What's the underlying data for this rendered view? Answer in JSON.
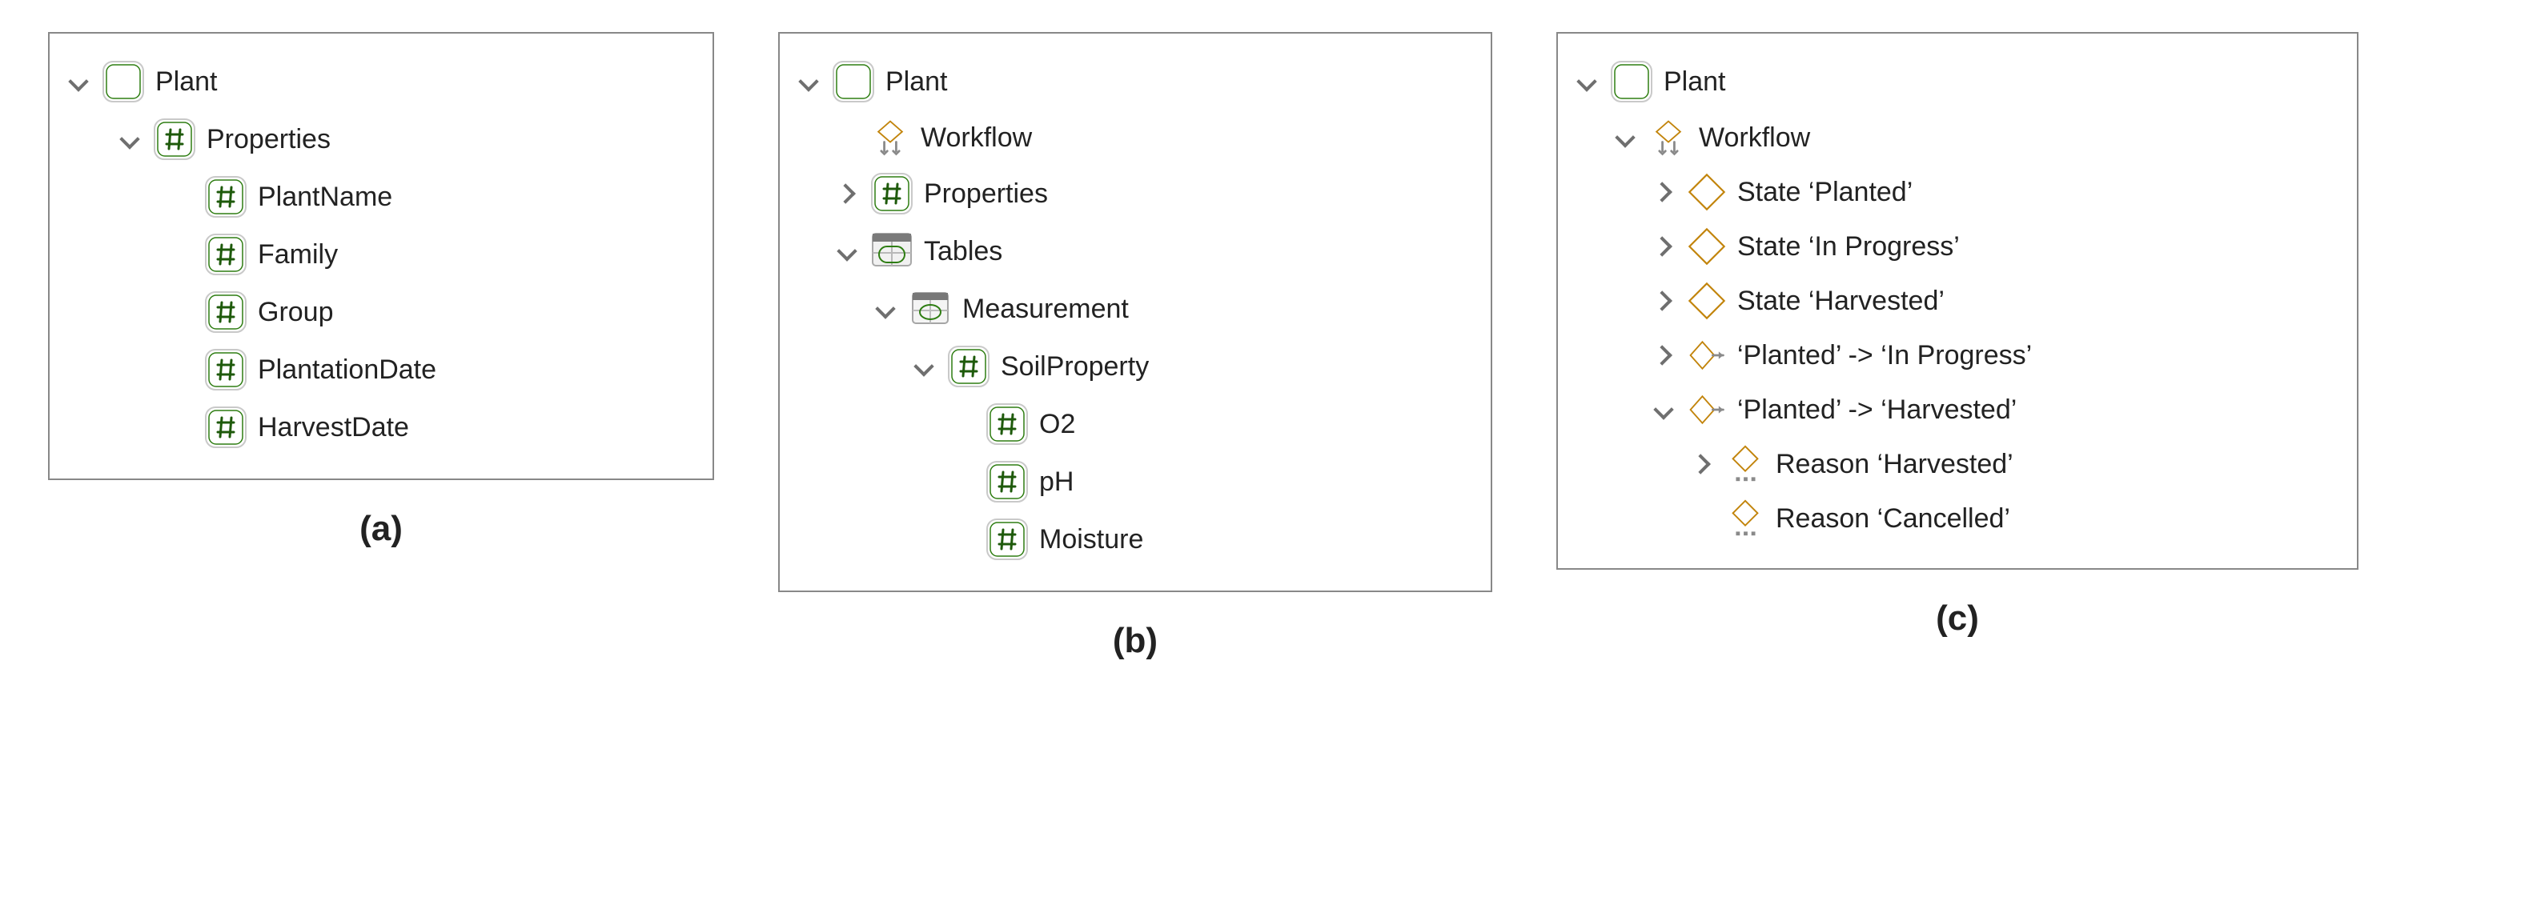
{
  "panels": {
    "a": {
      "caption": "(a)",
      "root_label": "Plant",
      "properties_label": "Properties",
      "properties": [
        "PlantName",
        "Family",
        "Group",
        "PlantationDate",
        "HarvestDate"
      ]
    },
    "b": {
      "caption": "(b)",
      "root_label": "Plant",
      "workflow_label": "Workflow",
      "properties_label": "Properties",
      "tables_label": "Tables",
      "measurement_label": "Measurement",
      "soilproperty_label": "SoilProperty",
      "soil_fields": [
        "O2",
        "pH",
        "Moisture"
      ]
    },
    "c": {
      "caption": "(c)",
      "root_label": "Plant",
      "workflow_label": "Workflow",
      "state_prefix": "State ",
      "states": [
        "‘Planted’",
        "‘In Progress’",
        "‘Harvested’"
      ],
      "transitions": [
        "‘Planted’ -> ‘In Progress’",
        "‘Planted’ -> ‘Harvested’"
      ],
      "reason_prefix": "Reason ",
      "reasons": [
        "‘Harvested’",
        "‘Cancelled’"
      ]
    }
  }
}
